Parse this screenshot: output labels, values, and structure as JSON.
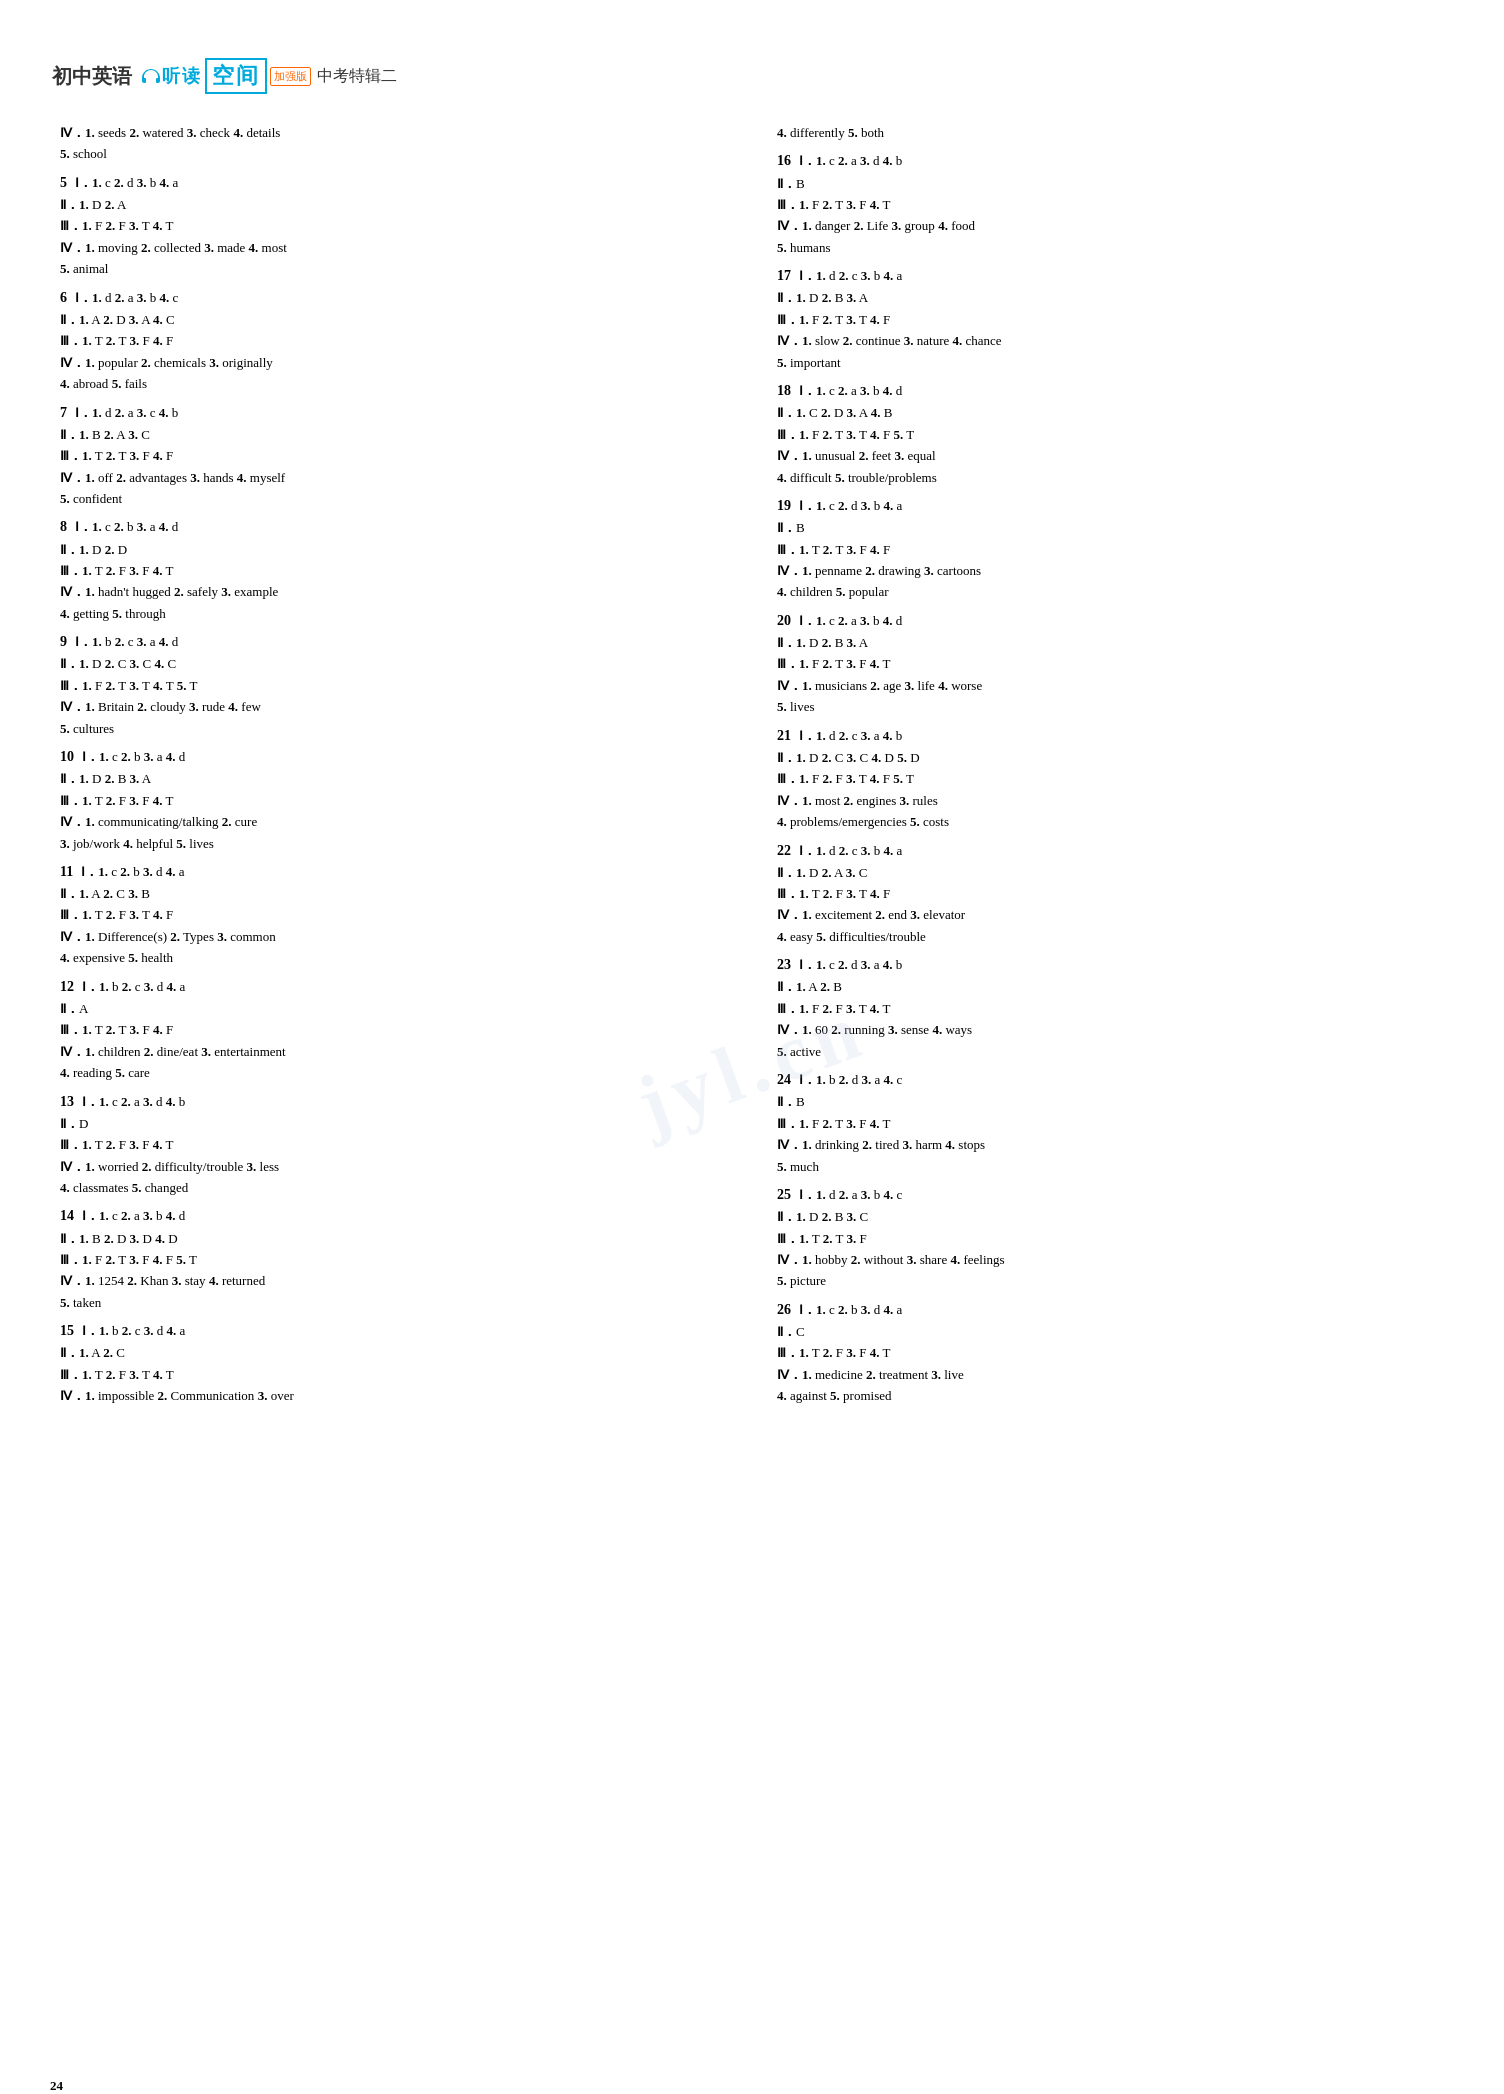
{
  "header": {
    "cn_title": "初中英语",
    "listen": "听",
    "read": "读",
    "space": "空间",
    "enhanced": "加强版",
    "zhongkao": "中考特辑二"
  },
  "page_number": "24",
  "watermark": "jyl.cn",
  "left_entries": [
    {
      "num": "",
      "lines": [
        "Ⅳ．1. seeds  2. watered  3. check  4. details",
        "   5. school"
      ]
    },
    {
      "num": "5",
      "lines": [
        "Ⅰ．1. c  2. d  3. b  4. a",
        "Ⅱ．1. D  2. A",
        "Ⅲ．1. F  2. F  3. T  4. T",
        "Ⅳ．1. moving  2. collected  3. made  4. most",
        "   5. animal"
      ]
    },
    {
      "num": "6",
      "lines": [
        "Ⅰ．1. d  2. a  3. b  4. c",
        "Ⅱ．1. A  2. D  3. A  4. C",
        "Ⅲ．1. T  2. T  3. F  4. F",
        "Ⅳ．1. popular  2. chemicals  3. originally",
        "   4. abroad  5. fails"
      ]
    },
    {
      "num": "7",
      "lines": [
        "Ⅰ．1. d  2. a  3. c  4. b",
        "Ⅱ．1. B  2. A  3. C",
        "Ⅲ．1. T  2. T  3. F  4. F",
        "Ⅳ．1. off  2. advantages  3. hands  4. myself",
        "   5. confident"
      ]
    },
    {
      "num": "8",
      "lines": [
        "Ⅰ．1. c  2. b  3. a  4. d",
        "Ⅱ．1. D  2. D",
        "Ⅲ．1. T  2. F  3. F  4. T",
        "Ⅳ．1. hadn't hugged  2. safely  3. example",
        "   4. getting  5. through"
      ]
    },
    {
      "num": "9",
      "lines": [
        "Ⅰ．1. b  2. c  3. a  4. d",
        "Ⅱ．1. D  2. C  3. C  4. C",
        "Ⅲ．1. F  2. T  3. T  4. T  5. T",
        "Ⅳ．1. Britain  2. cloudy  3. rude  4. few",
        "   5. cultures"
      ]
    },
    {
      "num": "10",
      "lines": [
        "Ⅰ．1. c  2. b  3. a  4. d",
        "Ⅱ．1. D  2. B  3. A",
        "Ⅲ．1. T  2. F  3. F  4. T",
        "Ⅳ．1. communicating/talking  2. cure",
        "   3. job/work  4. helpful  5. lives"
      ]
    },
    {
      "num": "11",
      "lines": [
        "Ⅰ．1. c  2. b  3. d  4. a",
        "Ⅱ．1. A  2. C  3. B",
        "Ⅲ．1. T  2. F  3. T  4. F",
        "Ⅳ．1. Difference(s)  2. Types  3. common",
        "   4. expensive  5. health"
      ]
    },
    {
      "num": "12",
      "lines": [
        "Ⅰ．1. b  2. c  3. d  4. a",
        "Ⅱ．A",
        "Ⅲ．1. T  2. T  3. F  4. F",
        "Ⅳ．1. children  2. dine/eat  3. entertainment",
        "   4. reading  5. care"
      ]
    },
    {
      "num": "13",
      "lines": [
        "Ⅰ．1. c  2. a  3. d  4. b",
        "Ⅱ．D",
        "Ⅲ．1. T  2. F  3. F  4. T",
        "Ⅳ．1. worried  2. difficulty/trouble  3. less",
        "   4. classmates  5. changed"
      ]
    },
    {
      "num": "14",
      "lines": [
        "Ⅰ．1. c  2. a  3. b  4. d",
        "Ⅱ．1. B  2. D  3. D  4. D",
        "Ⅲ．1. F  2. T  3. F  4. F  5. T",
        "Ⅳ．1. 1254  2. Khan  3. stay  4. returned",
        "   5. taken"
      ]
    },
    {
      "num": "15",
      "lines": [
        "Ⅰ．1. b  2. c  3. d  4. a",
        "Ⅱ．1. A  2. C",
        "Ⅲ．1. T  2. F  3. T  4. T",
        "Ⅳ．1. impossible  2. Communication  3. over"
      ]
    }
  ],
  "right_entries": [
    {
      "num": "",
      "lines": [
        "   4. differently  5. both"
      ]
    },
    {
      "num": "16",
      "lines": [
        "Ⅰ．1. c  2. a  3. d  4. b",
        "Ⅱ．B",
        "Ⅲ．1. F  2. T  3. F  4. T",
        "Ⅳ．1. danger  2. Life  3. group  4. food",
        "   5. humans"
      ]
    },
    {
      "num": "17",
      "lines": [
        "Ⅰ．1. d  2. c  3. b  4. a",
        "Ⅱ．1. D  2. B  3. A",
        "Ⅲ．1. F  2. T  3. T  4. F",
        "Ⅳ．1. slow  2. continue  3. nature  4. chance",
        "   5. important"
      ]
    },
    {
      "num": "18",
      "lines": [
        "Ⅰ．1. c  2. a  3. b  4. d",
        "Ⅱ．1. C  2. D  3. A  4. B",
        "Ⅲ．1. F  2. T  3. T  4. F  5. T",
        "Ⅳ．1. unusual  2. feet  3. equal",
        "   4. difficult  5. trouble/problems"
      ]
    },
    {
      "num": "19",
      "lines": [
        "Ⅰ．1. c  2. d  3. b  4. a",
        "Ⅱ．B",
        "Ⅲ．1. T  2. T  3. F  4. F",
        "Ⅳ．1. penname  2. drawing  3. cartoons",
        "   4. children  5. popular"
      ]
    },
    {
      "num": "20",
      "lines": [
        "Ⅰ．1. c  2. a  3. b  4. d",
        "Ⅱ．1. D  2. B  3. A",
        "Ⅲ．1. F  2. T  3. F  4. T",
        "Ⅳ．1. musicians  2. age  3. life  4. worse",
        "   5. lives"
      ]
    },
    {
      "num": "21",
      "lines": [
        "Ⅰ．1. d  2. c  3. a  4. b",
        "Ⅱ．1. D  2. C  3. C  4. D  5. D",
        "Ⅲ．1. F  2. F  3. T  4. F  5. T",
        "Ⅳ．1. most  2. engines  3. rules",
        "   4. problems/emergencies  5. costs"
      ]
    },
    {
      "num": "22",
      "lines": [
        "Ⅰ．1. d  2. c  3. b  4. a",
        "Ⅱ．1. D  2. A  3. C",
        "Ⅲ．1. T  2. F  3. T  4. F",
        "Ⅳ．1. excitement  2. end  3. elevator",
        "   4. easy  5. difficulties/trouble"
      ]
    },
    {
      "num": "23",
      "lines": [
        "Ⅰ．1. c  2. d  3. a  4. b",
        "Ⅱ．1. A  2. B",
        "Ⅲ．1. F  2. F  3. T  4. T",
        "Ⅳ．1. 60  2. running  3. sense  4. ways",
        "   5. active"
      ]
    },
    {
      "num": "24",
      "lines": [
        "Ⅰ．1. b  2. d  3. a  4. c",
        "Ⅱ．B",
        "Ⅲ．1. F  2. T  3. F  4. T",
        "Ⅳ．1. drinking  2. tired  3. harm  4. stops",
        "   5. much"
      ]
    },
    {
      "num": "25",
      "lines": [
        "Ⅰ．1. d  2. a  3. b  4. c",
        "Ⅱ．1. D  2. B  3. C",
        "Ⅲ．1. T  2. T  3. F",
        "Ⅳ．1. hobby  2. without  3. share  4. feelings",
        "   5. picture"
      ]
    },
    {
      "num": "26",
      "lines": [
        "Ⅰ．1. c  2. b  3. d  4. a",
        "Ⅱ．C",
        "Ⅲ．1. T  2. F  3. F  4. T",
        "Ⅳ．1. medicine  2. treatment  3. live",
        "   4. against  5. promised"
      ]
    }
  ]
}
